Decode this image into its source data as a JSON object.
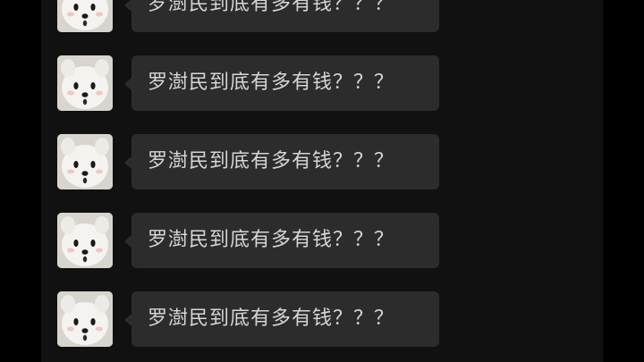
{
  "chat": {
    "messages": [
      {
        "sender_avatar": "samoyed-dog-avatar",
        "text": "罗澍民到底有多有钱？？？"
      },
      {
        "sender_avatar": "samoyed-dog-avatar",
        "text": "罗澍民到底有多有钱？？？"
      },
      {
        "sender_avatar": "samoyed-dog-avatar",
        "text": "罗澍民到底有多有钱？？？"
      },
      {
        "sender_avatar": "samoyed-dog-avatar",
        "text": "罗澍民到底有多有钱？？？"
      },
      {
        "sender_avatar": "samoyed-dog-avatar",
        "text": "罗澍民到底有多有钱？？？"
      }
    ]
  },
  "colors": {
    "background": "#000000",
    "panel": "#111111",
    "bubble": "#2c2c2c",
    "bubble_text": "#d6d6d6"
  }
}
